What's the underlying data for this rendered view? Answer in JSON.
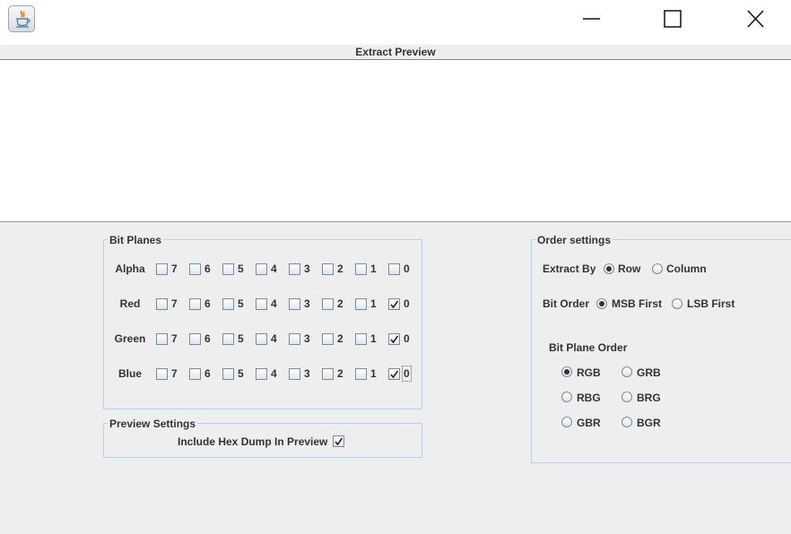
{
  "window": {
    "app_icon": "java-cup-icon",
    "controls": [
      "minimize-icon",
      "maximize-icon",
      "close-icon"
    ]
  },
  "preview": {
    "title": "Extract Preview"
  },
  "bit_planes": {
    "title": "Bit Planes",
    "bit_labels": [
      "7",
      "6",
      "5",
      "4",
      "3",
      "2",
      "1",
      "0"
    ],
    "rows": [
      {
        "label": "Alpha",
        "checked": [
          false,
          false,
          false,
          false,
          false,
          false,
          false,
          false
        ]
      },
      {
        "label": "Red",
        "checked": [
          false,
          false,
          false,
          false,
          false,
          false,
          false,
          true
        ]
      },
      {
        "label": "Green",
        "checked": [
          false,
          false,
          false,
          false,
          false,
          false,
          false,
          true
        ]
      },
      {
        "label": "Blue",
        "checked": [
          false,
          false,
          false,
          false,
          false,
          false,
          false,
          true
        ]
      }
    ]
  },
  "preview_settings": {
    "title": "Preview Settings",
    "hex_dump_label": "Include Hex Dump In Preview",
    "hex_dump_checked": true
  },
  "order_settings": {
    "title": "Order settings",
    "extract_by_label": "Extract By",
    "extract_by_options": [
      "Row",
      "Column"
    ],
    "extract_by_selected": "Row",
    "bit_order_label": "Bit Order",
    "bit_order_options": [
      "MSB First",
      "LSB First"
    ],
    "bit_order_selected": "MSB First",
    "bit_plane_order_label": "Bit Plane Order",
    "bit_plane_order_options": [
      "RGB",
      "GRB",
      "RBG",
      "BRG",
      "GBR",
      "BGR"
    ],
    "bit_plane_order_selected": "RGB"
  },
  "colors": {
    "background": "#eeeeee",
    "border": "#b8cfe5",
    "text": "#333333"
  }
}
